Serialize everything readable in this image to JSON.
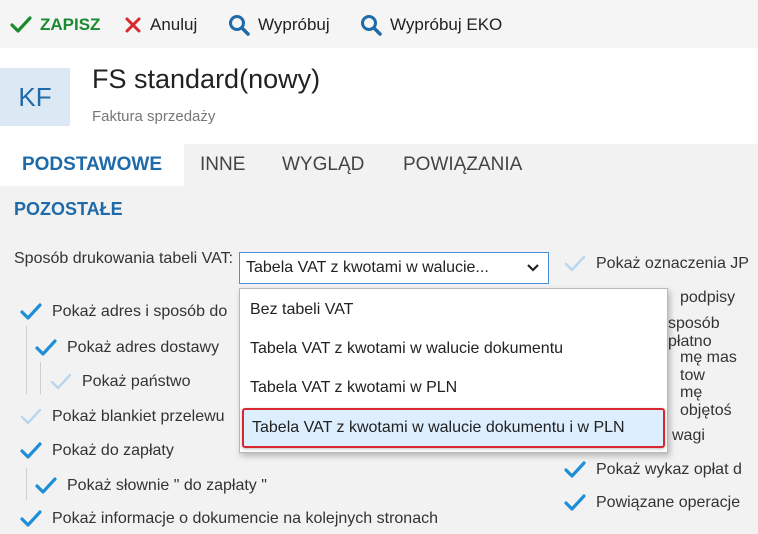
{
  "toolbar": {
    "save": "ZAPISZ",
    "cancel": "Anuluj",
    "try": "Wypróbuj",
    "try_eko": "Wypróbuj EKO"
  },
  "header": {
    "badge": "KF",
    "title": "FS standard(nowy)",
    "subtitle": "Faktura sprzedaży"
  },
  "tabs": [
    "PODSTAWOWE",
    "INNE",
    "WYGLĄD",
    "POWIĄZANIA"
  ],
  "section": {
    "title": "POZOSTAŁE"
  },
  "vat": {
    "label": "Sposób drukowania tabeli VAT:",
    "selected": "Tabela VAT z kwotami w walucie...",
    "options": [
      "Bez tabeli VAT",
      "Tabela VAT z kwotami w walucie dokumentu",
      "Tabela VAT z kwotami w PLN",
      "Tabela VAT z kwotami w walucie dokumentu i w PLN"
    ]
  },
  "left_checks": [
    {
      "label": "Pokaż adres i sposób do",
      "checked": true
    },
    {
      "label": "Pokaż adres dostawy",
      "checked": true
    },
    {
      "label": "Pokaż państwo",
      "checked": false
    },
    {
      "label": "Pokaż blankiet przelewu",
      "checked": false
    },
    {
      "label": "Pokaż do zapłaty",
      "checked": true
    },
    {
      "label": "Pokaż słownie \" do zapłaty \"",
      "checked": true
    },
    {
      "label": "Pokaż informacje o dokumencie na kolejnych stronach",
      "checked": true
    }
  ],
  "right_checks": [
    {
      "label": "Pokaż oznaczenia JP",
      "checked": false
    },
    {
      "label": "podpisy",
      "checked": true
    },
    {
      "label": "sposób płatno",
      "checked": true
    },
    {
      "label": "mę mas tow",
      "checked": true
    },
    {
      "label": "mę objętoś",
      "checked": true
    },
    {
      "label": "wagi",
      "checked": true
    },
    {
      "label": "Pokaż wykaz opłat d",
      "checked": true
    },
    {
      "label": "Powiązane operacje",
      "checked": true
    }
  ],
  "colors": {
    "accent": "#1f6aa8",
    "check": "#1e8fd6",
    "save": "#1a8a2e",
    "cancel": "#d6282e",
    "selection_border": "#d6282e"
  }
}
